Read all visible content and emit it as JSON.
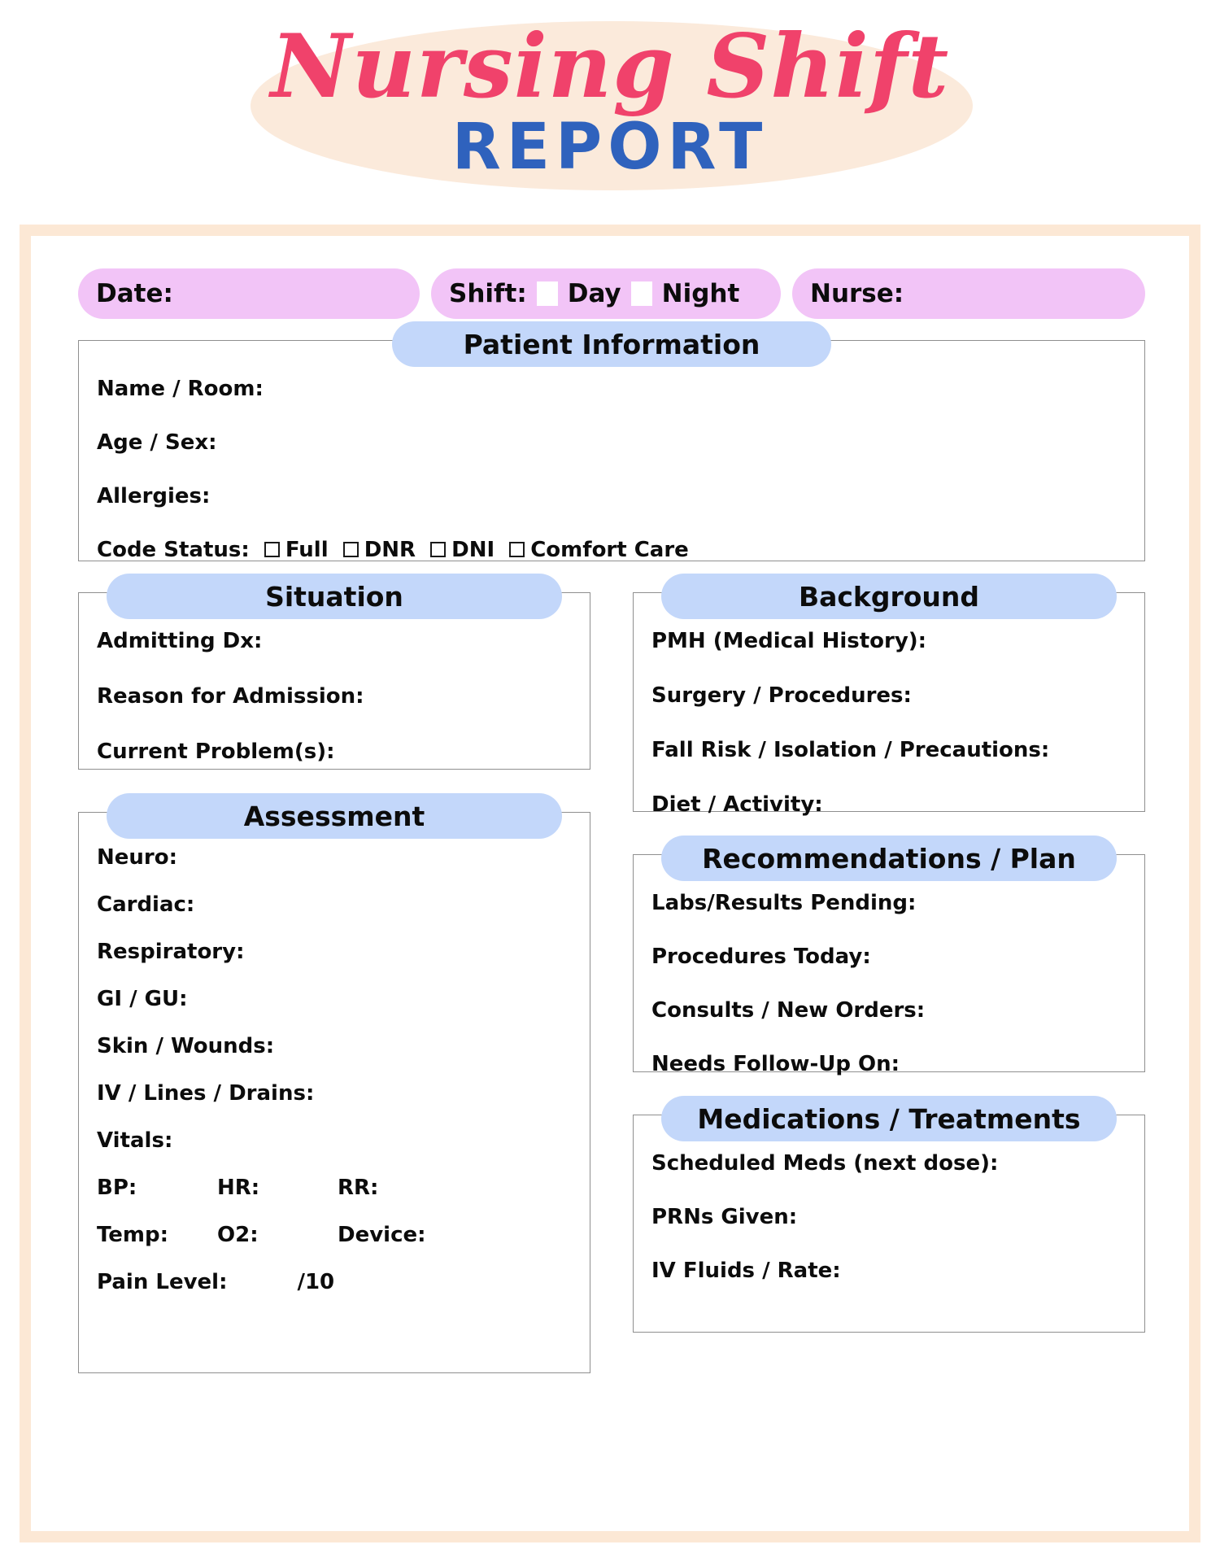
{
  "title": {
    "script_line": "Nursing Shift",
    "block_line": "REPORT"
  },
  "colors": {
    "title_script": "#f0426b",
    "title_block": "#2f62bd",
    "title_ellipse": "#fbeadb",
    "frame_border": "#fce8d5",
    "pill_pink": "#f2c4f7",
    "header_blue": "#c3d7fa",
    "box_border": "#8f8f8f",
    "text": "#0c0c0c"
  },
  "top_row": {
    "date_label": "Date:",
    "shift_label": "Shift:",
    "shift_options": [
      "Day",
      "Night"
    ],
    "nurse_label": "Nurse:"
  },
  "sections": {
    "patient_information": {
      "header": "Patient Information",
      "fields": [
        "Name / Room:",
        "Age / Sex:",
        "Allergies:"
      ],
      "code_status_label": "Code Status:",
      "code_status_options": [
        "Full",
        "DNR",
        "DNI",
        "Comfort Care"
      ]
    },
    "situation": {
      "header": "Situation",
      "fields": [
        "Admitting Dx:",
        "Reason for Admission:",
        "Current Problem(s):"
      ]
    },
    "background": {
      "header": "Background",
      "fields": [
        "PMH (Medical History):",
        "Surgery / Procedures:",
        "Fall Risk / Isolation / Precautions:",
        "Diet / Activity:"
      ]
    },
    "assessment": {
      "header": "Assessment",
      "fields": [
        "Neuro:",
        "Cardiac:",
        "Respiratory:",
        "GI / GU:",
        "Skin / Wounds:",
        "IV / Lines / Drains:",
        "Vitals:"
      ],
      "vitals_row_1": [
        "BP:",
        "HR:",
        "RR:"
      ],
      "vitals_row_2": [
        "Temp:",
        "O2:",
        "Device:"
      ],
      "pain_label": "Pain Level:",
      "pain_scale": "/10"
    },
    "recommendations_plan": {
      "header": "Recommendations / Plan",
      "fields": [
        "Labs/Results Pending:",
        "Procedures Today:",
        "Consults / New Orders:",
        "Needs Follow-Up On:"
      ]
    },
    "medications_treatments": {
      "header": "Medications / Treatments",
      "fields": [
        "Scheduled Meds (next dose):",
        "PRNs Given:",
        "IV Fluids / Rate:"
      ]
    }
  }
}
